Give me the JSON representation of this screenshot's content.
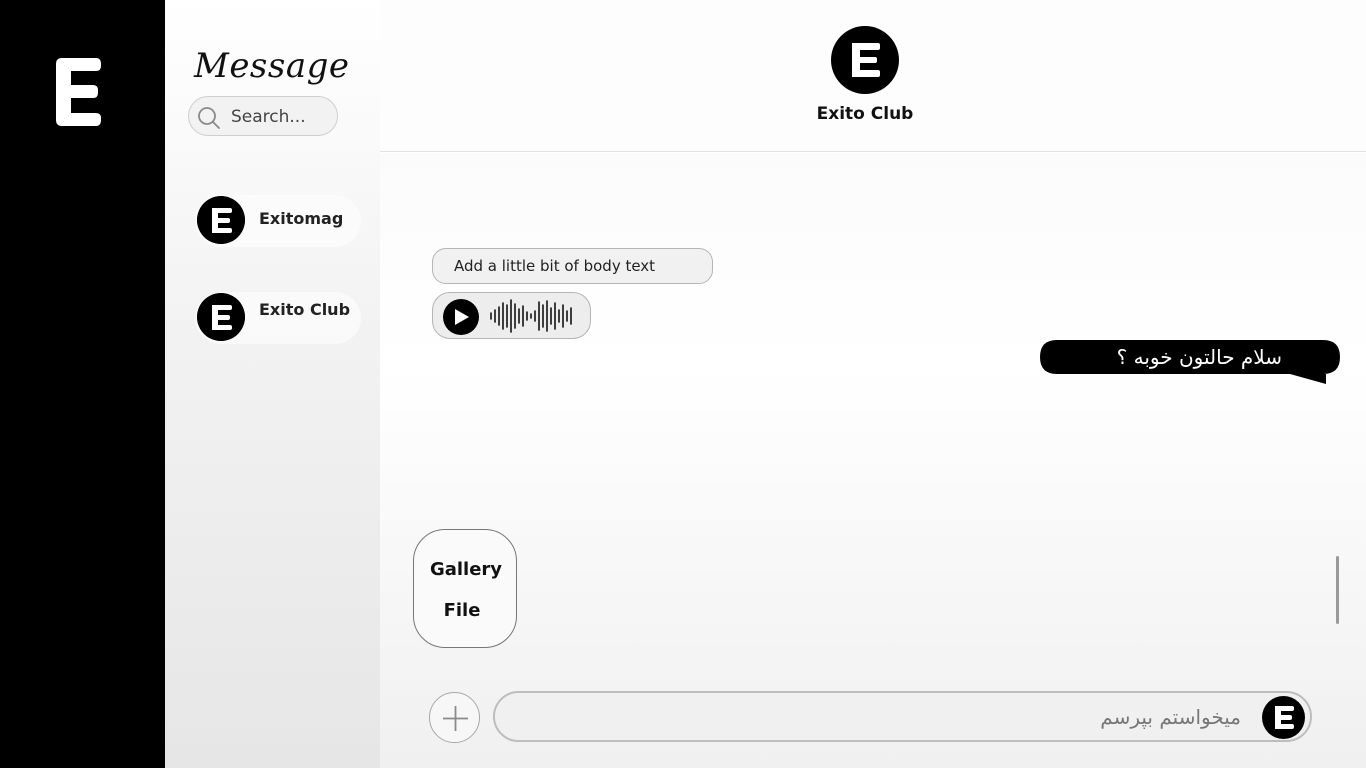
{
  "rail": {
    "logo_icon": "brand-e-logo"
  },
  "sidebar": {
    "title": "Message",
    "search": {
      "placeholder": "Search...",
      "value": "",
      "icon": "search-icon"
    },
    "contacts": [
      {
        "name": "Exitomag",
        "avatar_icon": "brand-e-avatar"
      },
      {
        "name": "Exito Club",
        "avatar_icon": "brand-e-avatar"
      }
    ]
  },
  "chat": {
    "header": {
      "name": "Exito Club",
      "avatar_icon": "brand-e-avatar"
    },
    "messages": [
      {
        "direction": "incoming",
        "type": "text",
        "text": "Add a little bit of body text"
      },
      {
        "direction": "incoming",
        "type": "voice",
        "icon": "play-icon"
      },
      {
        "direction": "outgoing",
        "type": "text",
        "text": "سلام حالتون خوبه ؟"
      }
    ],
    "attach_menu": {
      "items": [
        "Gallery",
        "File"
      ]
    },
    "composer": {
      "placeholder": "میخواستم بپرسم",
      "value": "",
      "add_icon": "plus-icon",
      "avatar_icon": "brand-e-avatar"
    }
  },
  "colors": {
    "primary": "#000000",
    "sidebar_bg": "#f0f0f0",
    "bubble_bg": "#f1f1f1",
    "outgoing_bubble": "#000000"
  }
}
